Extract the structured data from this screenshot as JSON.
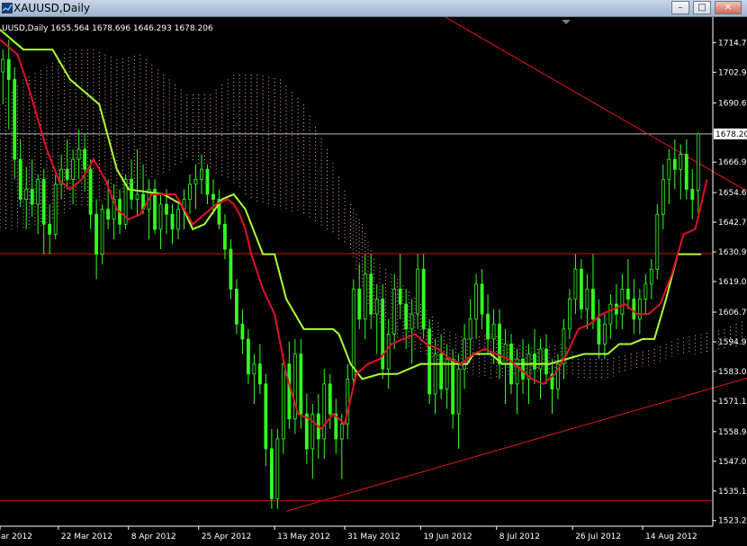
{
  "window": {
    "title": "XAUUSD,Daily",
    "buttons": {
      "minimize": "–",
      "maximize": "□",
      "close": "✕"
    }
  },
  "chart_data": {
    "type": "line",
    "title": "UUSD,Daily  1655.564 1678.696 1646.293 1678.206",
    "symbol_label": "XAUUSD,Daily",
    "ohlc": {
      "open": 1655.564,
      "high": 1678.696,
      "low": 1646.293,
      "close": 1678.206
    },
    "current_price": "1678.20",
    "ylim": [
      1521,
      1725
    ],
    "xlim": [
      0,
      122
    ],
    "y_ticks": [
      {
        "v": 1714.78,
        "label": "1714.78"
      },
      {
        "v": 1702.9,
        "label": "1702.90"
      },
      {
        "v": 1690.66,
        "label": "1690.66"
      },
      {
        "v": 1666.9,
        "label": "1666.90"
      },
      {
        "v": 1654.66,
        "label": "1654.66"
      },
      {
        "v": 1642.78,
        "label": "1642.78"
      },
      {
        "v": 1630.9,
        "label": "1630.90"
      },
      {
        "v": 1619.02,
        "label": "1619.02"
      },
      {
        "v": 1606.78,
        "label": "1606.78"
      },
      {
        "v": 1594.9,
        "label": "1594.90"
      },
      {
        "v": 1583.02,
        "label": "1583.02"
      },
      {
        "v": 1571.14,
        "label": "1571.14"
      },
      {
        "v": 1558.9,
        "label": "1558.90"
      },
      {
        "v": 1547.02,
        "label": "1547.02"
      },
      {
        "v": 1535.14,
        "label": "1535.14"
      },
      {
        "v": 1523.26,
        "label": "1523.26"
      }
    ],
    "x_ticks": [
      {
        "x": 0,
        "label": "ar 2012"
      },
      {
        "x": 10,
        "label": "22 Mar 2012"
      },
      {
        "x": 22,
        "label": "8 Apr 2012"
      },
      {
        "x": 34,
        "label": "25 Apr 2012"
      },
      {
        "x": 47,
        "label": "13 May 2012"
      },
      {
        "x": 59,
        "label": "31 May 2012"
      },
      {
        "x": 72,
        "label": "19 Jun 2012"
      },
      {
        "x": 85,
        "label": "8 Jul 2012"
      },
      {
        "x": 98,
        "label": "26 Jul 2012"
      },
      {
        "x": 110,
        "label": "14 Aug 2012"
      }
    ],
    "horizontal_lines": [
      1678.2,
      1630.2,
      1531.2
    ],
    "trendlines": [
      {
        "name": "upper",
        "x1": 54,
        "y1": 1755,
        "x2": 151,
        "y2": 1624
      },
      {
        "name": "lower",
        "x1": 49,
        "y1": 1527,
        "x2": 151,
        "y2": 1596
      }
    ],
    "candles": [
      [
        1703,
        1712,
        1690,
        1708
      ],
      [
        1708,
        1716,
        1680,
        1700
      ],
      [
        1700,
        1705,
        1660,
        1668
      ],
      [
        1668,
        1676,
        1649,
        1652
      ],
      [
        1652,
        1665,
        1640,
        1656
      ],
      [
        1656,
        1668,
        1645,
        1650
      ],
      [
        1650,
        1662,
        1638,
        1660
      ],
      [
        1660,
        1664,
        1630,
        1642
      ],
      [
        1642,
        1650,
        1630,
        1638
      ],
      [
        1638,
        1662,
        1636,
        1658
      ],
      [
        1658,
        1670,
        1652,
        1664
      ],
      [
        1664,
        1676,
        1656,
        1660
      ],
      [
        1660,
        1672,
        1650,
        1668
      ],
      [
        1668,
        1680,
        1660,
        1672
      ],
      [
        1672,
        1678,
        1655,
        1664
      ],
      [
        1664,
        1668,
        1640,
        1646
      ],
      [
        1646,
        1652,
        1620,
        1630
      ],
      [
        1630,
        1650,
        1626,
        1648
      ],
      [
        1648,
        1660,
        1640,
        1644
      ],
      [
        1644,
        1658,
        1636,
        1652
      ],
      [
        1652,
        1656,
        1638,
        1642
      ],
      [
        1642,
        1662,
        1640,
        1660
      ],
      [
        1660,
        1668,
        1648,
        1652
      ],
      [
        1652,
        1672,
        1645,
        1654
      ],
      [
        1654,
        1666,
        1646,
        1648
      ],
      [
        1648,
        1660,
        1636,
        1656
      ],
      [
        1656,
        1660,
        1638,
        1640
      ],
      [
        1640,
        1654,
        1632,
        1650
      ],
      [
        1650,
        1656,
        1638,
        1646
      ],
      [
        1646,
        1650,
        1634,
        1640
      ],
      [
        1640,
        1650,
        1636,
        1648
      ],
      [
        1648,
        1656,
        1640,
        1652
      ],
      [
        1652,
        1662,
        1646,
        1658
      ],
      [
        1658,
        1666,
        1648,
        1660
      ],
      [
        1660,
        1670,
        1654,
        1664
      ],
      [
        1664,
        1666,
        1650,
        1654
      ],
      [
        1654,
        1660,
        1646,
        1652
      ],
      [
        1652,
        1656,
        1640,
        1642
      ],
      [
        1642,
        1646,
        1628,
        1632
      ],
      [
        1632,
        1636,
        1612,
        1616
      ],
      [
        1616,
        1620,
        1598,
        1602
      ],
      [
        1602,
        1608,
        1590,
        1596
      ],
      [
        1596,
        1600,
        1578,
        1582
      ],
      [
        1582,
        1590,
        1570,
        1586
      ],
      [
        1586,
        1594,
        1574,
        1578
      ],
      [
        1578,
        1582,
        1545,
        1552
      ],
      [
        1552,
        1560,
        1528,
        1532
      ],
      [
        1532,
        1560,
        1528,
        1556
      ],
      [
        1556,
        1590,
        1550,
        1586
      ],
      [
        1586,
        1595,
        1560,
        1564
      ],
      [
        1564,
        1596,
        1558,
        1590
      ],
      [
        1590,
        1596,
        1560,
        1566
      ],
      [
        1566,
        1574,
        1546,
        1552
      ],
      [
        1552,
        1570,
        1540,
        1566
      ],
      [
        1566,
        1574,
        1548,
        1556
      ],
      [
        1556,
        1584,
        1548,
        1578
      ],
      [
        1578,
        1582,
        1560,
        1566
      ],
      [
        1566,
        1572,
        1550,
        1556
      ],
      [
        1556,
        1566,
        1540,
        1562
      ],
      [
        1562,
        1586,
        1556,
        1580
      ],
      [
        1580,
        1620,
        1576,
        1616
      ],
      [
        1616,
        1626,
        1600,
        1604
      ],
      [
        1604,
        1630,
        1596,
        1622
      ],
      [
        1622,
        1630,
        1600,
        1606
      ],
      [
        1606,
        1618,
        1590,
        1612
      ],
      [
        1612,
        1618,
        1580,
        1584
      ],
      [
        1584,
        1604,
        1576,
        1598
      ],
      [
        1598,
        1622,
        1592,
        1616
      ],
      [
        1616,
        1630,
        1604,
        1610
      ],
      [
        1610,
        1616,
        1592,
        1600
      ],
      [
        1600,
        1612,
        1586,
        1606
      ],
      [
        1606,
        1630,
        1600,
        1624
      ],
      [
        1624,
        1630,
        1596,
        1600
      ],
      [
        1600,
        1604,
        1570,
        1574
      ],
      [
        1574,
        1596,
        1566,
        1590
      ],
      [
        1590,
        1598,
        1572,
        1576
      ],
      [
        1576,
        1594,
        1568,
        1588
      ],
      [
        1588,
        1592,
        1560,
        1566
      ],
      [
        1566,
        1590,
        1552,
        1584
      ],
      [
        1584,
        1602,
        1576,
        1596
      ],
      [
        1596,
        1612,
        1588,
        1604
      ],
      [
        1604,
        1622,
        1596,
        1618
      ],
      [
        1618,
        1624,
        1600,
        1606
      ],
      [
        1606,
        1614,
        1590,
        1596
      ],
      [
        1596,
        1608,
        1586,
        1602
      ],
      [
        1602,
        1608,
        1580,
        1586
      ],
      [
        1586,
        1600,
        1570,
        1594
      ],
      [
        1594,
        1598,
        1574,
        1578
      ],
      [
        1578,
        1592,
        1566,
        1588
      ],
      [
        1588,
        1596,
        1574,
        1580
      ],
      [
        1580,
        1594,
        1570,
        1590
      ],
      [
        1590,
        1600,
        1578,
        1584
      ],
      [
        1584,
        1596,
        1572,
        1592
      ],
      [
        1592,
        1598,
        1578,
        1582
      ],
      [
        1582,
        1588,
        1566,
        1576
      ],
      [
        1576,
        1590,
        1572,
        1586
      ],
      [
        1586,
        1604,
        1580,
        1600
      ],
      [
        1600,
        1616,
        1596,
        1612
      ],
      [
        1612,
        1630,
        1606,
        1624
      ],
      [
        1624,
        1628,
        1604,
        1608
      ],
      [
        1608,
        1622,
        1600,
        1616
      ],
      [
        1616,
        1630,
        1600,
        1604
      ],
      [
        1604,
        1612,
        1588,
        1594
      ],
      [
        1594,
        1606,
        1588,
        1602
      ],
      [
        1602,
        1614,
        1596,
        1610
      ],
      [
        1610,
        1618,
        1600,
        1606
      ],
      [
        1606,
        1622,
        1600,
        1616
      ],
      [
        1616,
        1628,
        1608,
        1612
      ],
      [
        1612,
        1620,
        1598,
        1604
      ],
      [
        1604,
        1616,
        1598,
        1612
      ],
      [
        1612,
        1622,
        1606,
        1618
      ],
      [
        1618,
        1628,
        1612,
        1624
      ],
      [
        1624,
        1650,
        1620,
        1646
      ],
      [
        1646,
        1666,
        1640,
        1660
      ],
      [
        1660,
        1672,
        1650,
        1668
      ],
      [
        1668,
        1676,
        1656,
        1664
      ],
      [
        1664,
        1674,
        1652,
        1670
      ],
      [
        1670,
        1676,
        1652,
        1656
      ],
      [
        1656,
        1664,
        1644,
        1652
      ],
      [
        1655.564,
        1678.696,
        1646.293,
        1678.206
      ]
    ],
    "series": [
      {
        "type": "line",
        "color": "#adff2f",
        "points": [
          [
            0,
            1720
          ],
          [
            4,
            1712
          ],
          [
            9,
            1712
          ],
          [
            12,
            1700
          ],
          [
            17,
            1690
          ],
          [
            20,
            1664
          ],
          [
            22,
            1656
          ],
          [
            28,
            1654
          ],
          [
            31,
            1650
          ],
          [
            33,
            1640
          ],
          [
            35,
            1642
          ],
          [
            38,
            1652
          ],
          [
            40,
            1654
          ],
          [
            42,
            1648
          ],
          [
            43,
            1642
          ],
          [
            45,
            1630
          ],
          [
            47,
            1630
          ],
          [
            49,
            1612
          ],
          [
            52,
            1600
          ],
          [
            55,
            1600
          ],
          [
            57,
            1600
          ],
          [
            58,
            1598
          ],
          [
            60,
            1586
          ],
          [
            62,
            1580
          ],
          [
            65,
            1582
          ],
          [
            68,
            1582
          ],
          [
            72,
            1586
          ],
          [
            78,
            1586
          ],
          [
            80,
            1586
          ],
          [
            81,
            1590
          ],
          [
            84,
            1590
          ],
          [
            86,
            1586
          ],
          [
            94,
            1586
          ],
          [
            100,
            1590
          ],
          [
            104,
            1590
          ],
          [
            106,
            1594
          ],
          [
            108,
            1594
          ],
          [
            110,
            1596
          ],
          [
            112,
            1596
          ],
          [
            114,
            1612
          ],
          [
            116,
            1630
          ],
          [
            118,
            1630
          ],
          [
            120,
            1630
          ]
        ]
      },
      {
        "type": "line",
        "color": "#e0102a",
        "points": [
          [
            0,
            1716
          ],
          [
            3,
            1710
          ],
          [
            5,
            1696
          ],
          [
            8,
            1672
          ],
          [
            10,
            1660
          ],
          [
            12,
            1656
          ],
          [
            14,
            1660
          ],
          [
            16,
            1668
          ],
          [
            18,
            1660
          ],
          [
            20,
            1648
          ],
          [
            22,
            1644
          ],
          [
            24,
            1646
          ],
          [
            26,
            1654
          ],
          [
            28,
            1654
          ],
          [
            30,
            1654
          ],
          [
            32,
            1646
          ],
          [
            33,
            1642
          ],
          [
            35,
            1646
          ],
          [
            37,
            1650
          ],
          [
            39,
            1652
          ],
          [
            40,
            1650
          ],
          [
            41,
            1646
          ],
          [
            42,
            1640
          ],
          [
            43,
            1630
          ],
          [
            45,
            1616
          ],
          [
            47,
            1606
          ],
          [
            49,
            1582
          ],
          [
            51,
            1566
          ],
          [
            53,
            1564
          ],
          [
            55,
            1560
          ],
          [
            57,
            1566
          ],
          [
            59,
            1562
          ],
          [
            61,
            1582
          ],
          [
            63,
            1586
          ],
          [
            65,
            1588
          ],
          [
            67,
            1594
          ],
          [
            69,
            1596
          ],
          [
            71,
            1598
          ],
          [
            73,
            1594
          ],
          [
            75,
            1592
          ],
          [
            77,
            1588
          ],
          [
            79,
            1586
          ],
          [
            81,
            1590
          ],
          [
            83,
            1592
          ],
          [
            85,
            1590
          ],
          [
            87,
            1588
          ],
          [
            89,
            1584
          ],
          [
            91,
            1580
          ],
          [
            93,
            1578
          ],
          [
            95,
            1582
          ],
          [
            97,
            1590
          ],
          [
            99,
            1600
          ],
          [
            101,
            1602
          ],
          [
            103,
            1606
          ],
          [
            105,
            1608
          ],
          [
            107,
            1610
          ],
          [
            109,
            1606
          ],
          [
            111,
            1606
          ],
          [
            113,
            1610
          ],
          [
            115,
            1622
          ],
          [
            117,
            1638
          ],
          [
            119,
            1640
          ],
          [
            121,
            1660
          ]
        ]
      }
    ],
    "cloud": [
      [
        0,
        1690,
        1640
      ],
      [
        4,
        1700,
        1640
      ],
      [
        8,
        1705,
        1642
      ],
      [
        12,
        1712,
        1648
      ],
      [
        16,
        1712,
        1650
      ],
      [
        20,
        1708,
        1652
      ],
      [
        24,
        1710,
        1660
      ],
      [
        28,
        1702,
        1662
      ],
      [
        32,
        1694,
        1668
      ],
      [
        36,
        1694,
        1664
      ],
      [
        40,
        1702,
        1658
      ],
      [
        44,
        1702,
        1650
      ],
      [
        48,
        1700,
        1648
      ],
      [
        52,
        1690,
        1646
      ],
      [
        56,
        1672,
        1640
      ],
      [
        60,
        1650,
        1632
      ],
      [
        62,
        1642,
        1616
      ],
      [
        64,
        1628,
        1604
      ],
      [
        68,
        1620,
        1596
      ],
      [
        72,
        1610,
        1590
      ],
      [
        76,
        1600,
        1586
      ],
      [
        80,
        1596,
        1582
      ],
      [
        84,
        1598,
        1580
      ],
      [
        88,
        1594,
        1582
      ],
      [
        92,
        1592,
        1582
      ],
      [
        96,
        1594,
        1582
      ],
      [
        100,
        1588,
        1580
      ],
      [
        104,
        1588,
        1580
      ],
      [
        108,
        1590,
        1584
      ],
      [
        112,
        1592,
        1586
      ],
      [
        116,
        1596,
        1590
      ],
      [
        120,
        1598,
        1590
      ],
      [
        124,
        1600,
        1592
      ],
      [
        128,
        1604,
        1594
      ],
      [
        130,
        1610,
        1602
      ],
      [
        132,
        1618,
        1604
      ],
      [
        134,
        1630,
        1608
      ],
      [
        136,
        1638,
        1614
      ],
      [
        138,
        1644,
        1620
      ],
      [
        140,
        1648,
        1626
      ]
    ]
  }
}
